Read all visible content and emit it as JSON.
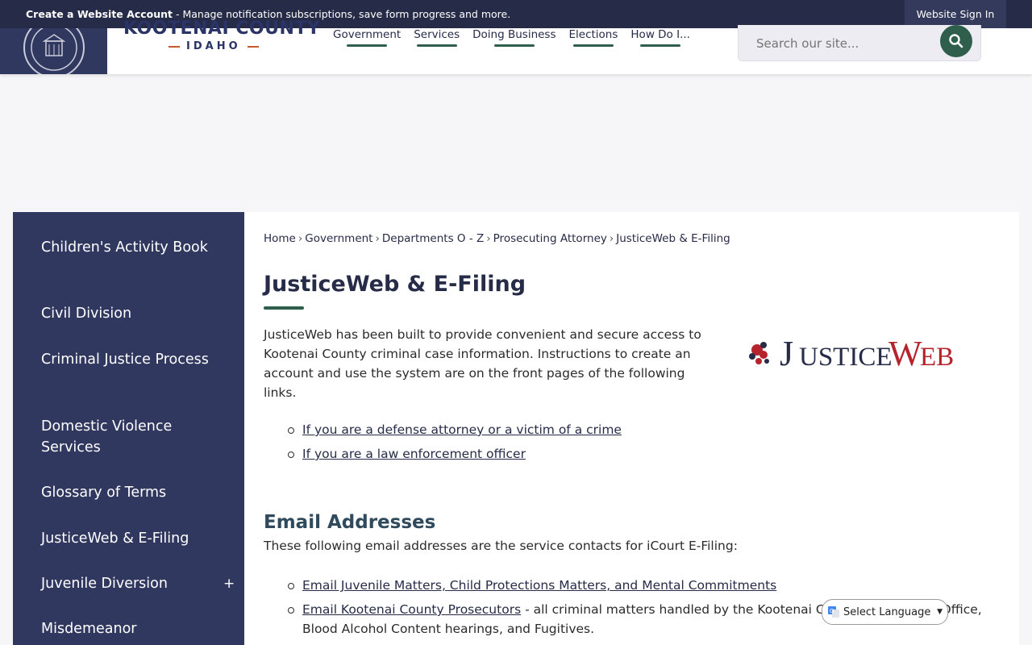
{
  "topbar": {
    "bold": "Create a Website Account",
    "message": " - Manage notification subscriptions, save form progress and more.",
    "signin": "Website Sign In"
  },
  "header": {
    "brand_name": "KOOTENAI COUNTY",
    "brand_state": "IDAHO",
    "nav": [
      "Government",
      "Services",
      "Doing Business",
      "Elections",
      "How Do I..."
    ],
    "search_placeholder": "Search our site..."
  },
  "sidebar": {
    "items": [
      {
        "label": "Children's Activity Book"
      },
      {
        "label": "Civil Division"
      },
      {
        "label": "Criminal Justice Process"
      },
      {
        "label": "Domestic Violence Services"
      },
      {
        "label": "Glossary of Terms"
      },
      {
        "label": "JusticeWeb & E-Filing"
      },
      {
        "label": "Juvenile Diversion",
        "expand": "+"
      },
      {
        "label": "Misdemeanor"
      }
    ]
  },
  "breadcrumb": [
    "Home",
    "Government",
    "Departments O - Z",
    "Prosecuting Attorney",
    "JusticeWeb & E-Filing"
  ],
  "page": {
    "title": "JusticeWeb & E-Filing",
    "intro": "JusticeWeb has been built to provide convenient and secure access to Kootenai County criminal case information. Instructions to create an account and use the system are on the front pages of the following links.",
    "logo_text_1": "J",
    "logo_text_2": "USTICE",
    "logo_text_3": "W",
    "logo_text_4": "EB",
    "links": [
      "If you are a defense attorney or a victim of a crime",
      "If you are a law enforcement officer"
    ],
    "email_heading": "Email Addresses",
    "email_intro": "These following email addresses are the service contacts for iCourt E-Filing:",
    "email_links": [
      {
        "link": "Email Juvenile Matters, Child Protections Matters, and Mental Commitments",
        "suffix": ""
      },
      {
        "link": "Email Kootenai County Prosecutors",
        "suffix": " - all criminal matters handled by the Kootenai County Prosecutors Office, Blood Alcohol Content hearings, and Fugitives."
      }
    ]
  },
  "language": {
    "label": "Select Language"
  },
  "colors": {
    "navy": "#262b47",
    "sidebar": "#313860",
    "accent_green": "#2f5e4c",
    "brand_orange": "#c65a2e",
    "logo_red": "#b5232d"
  }
}
